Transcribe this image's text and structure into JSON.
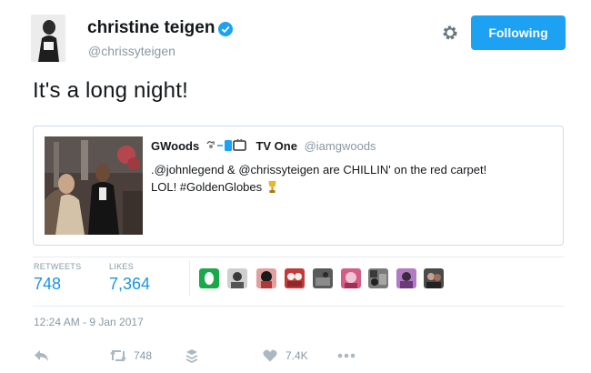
{
  "header": {
    "display_name": "christine teigen",
    "handle": "@chrissyteigen",
    "follow_label": "Following"
  },
  "tweet": {
    "text": "It's a long night!",
    "timestamp": "12:24 AM - 9 Jan 2017"
  },
  "quoted": {
    "name": "GWoods",
    "name_suffix": "TV One",
    "handle": "@iamgwoods",
    "text_line1": ".@johnlegend & @chrissyteigen are CHILLIN' on the red carpet!",
    "text_line2": "LOL! #GoldenGlobes"
  },
  "stats": {
    "retweets_label": "RETWEETS",
    "retweets_value": "748",
    "likes_label": "LIKES",
    "likes_value": "7,364"
  },
  "actions": {
    "retweet_count": "748",
    "like_count": "7.4K"
  },
  "colors": {
    "accent": "#1da1f2",
    "link": "#1b95e0",
    "muted": "#8899a6",
    "border": "#cfdbe6"
  },
  "icons": [
    "verified-badge-icon",
    "gear-icon",
    "reply-icon",
    "retweet-icon",
    "stack-icon",
    "heart-icon",
    "more-icon",
    "trophy-icon"
  ]
}
